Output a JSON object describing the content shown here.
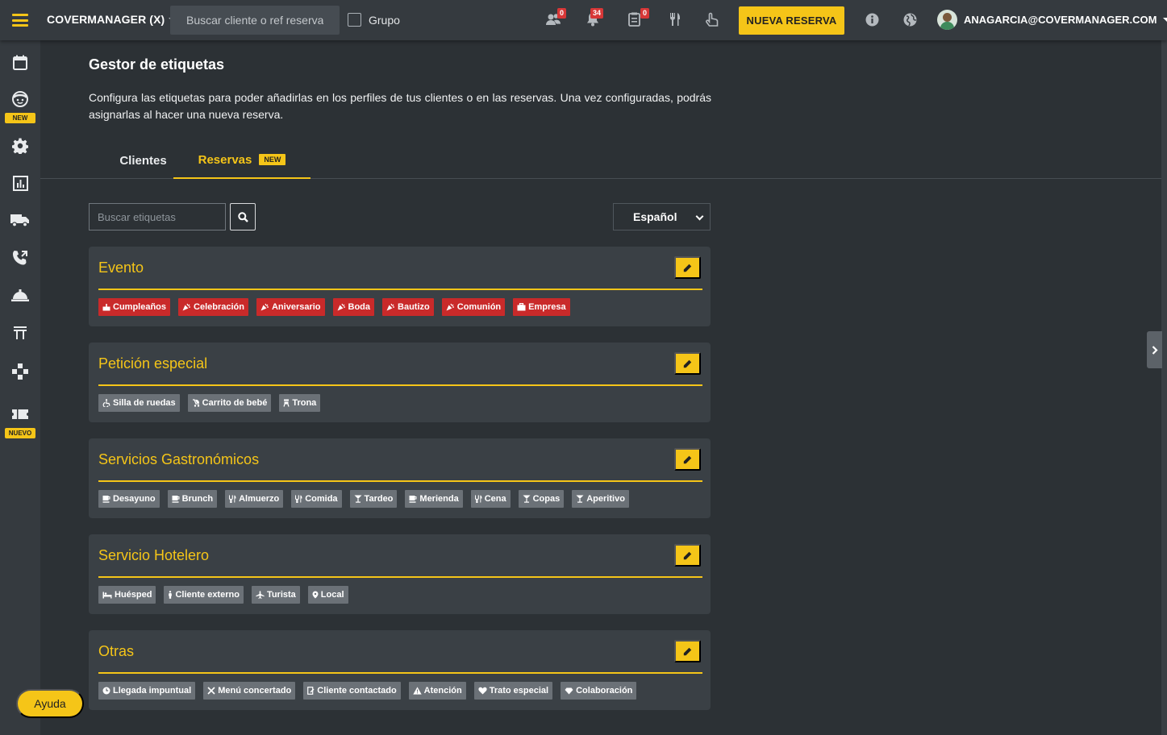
{
  "topbar": {
    "brand": "COVERMANAGER (X)",
    "search_placeholder": "Buscar cliente o ref reserva",
    "group_label": "Grupo",
    "badges": {
      "waitlist": "0",
      "notifications": "34",
      "requests": "0"
    },
    "new_reservation": "NUEVA RESERVA",
    "user_email": "ANAGARCIA@COVERMANAGER.COM"
  },
  "sidebar": {
    "badge_new": "NEW",
    "badge_nuevo": "NUEVO"
  },
  "page": {
    "title": "Gestor de etiquetas",
    "description": "Configura las etiquetas para poder añadirlas en los perfiles de tus clientes o en las reservas. Una vez configuradas, podrás asignarlas al hacer una nueva reserva."
  },
  "tabs": {
    "clientes": "Clientes",
    "reservas": "Reservas",
    "reservas_badge": "NEW"
  },
  "filters": {
    "search_placeholder": "Buscar etiquetas",
    "language": "Español"
  },
  "categories": [
    {
      "title": "Evento",
      "tags": [
        "Cumpleaños",
        "Celebración",
        "Aniversario",
        "Boda",
        "Bautizo",
        "Comunión",
        "Empresa"
      ]
    },
    {
      "title": "Petición especial",
      "tags": [
        "Silla de ruedas",
        "Carrito de bebé",
        "Trona"
      ]
    },
    {
      "title": "Servicios Gastronómicos",
      "tags": [
        "Desayuno",
        "Brunch",
        "Almuerzo",
        "Comida",
        "Tardeo",
        "Merienda",
        "Cena",
        "Copas",
        "Aperitivo"
      ]
    },
    {
      "title": "Servicio Hotelero",
      "tags": [
        "Huésped",
        "Cliente externo",
        "Turista",
        "Local"
      ]
    },
    {
      "title": "Otras",
      "tags": [
        "Llegada impuntual",
        "Menú concertado",
        "Cliente contactado",
        "Atención",
        "Trato especial",
        "Colaboración"
      ]
    }
  ],
  "colors": {
    "accent": "#f5c518",
    "tag_red": "#c92a2a",
    "tag_gray": "#6b7177",
    "background": "#2c3135"
  },
  "help_button": "Ayuda"
}
